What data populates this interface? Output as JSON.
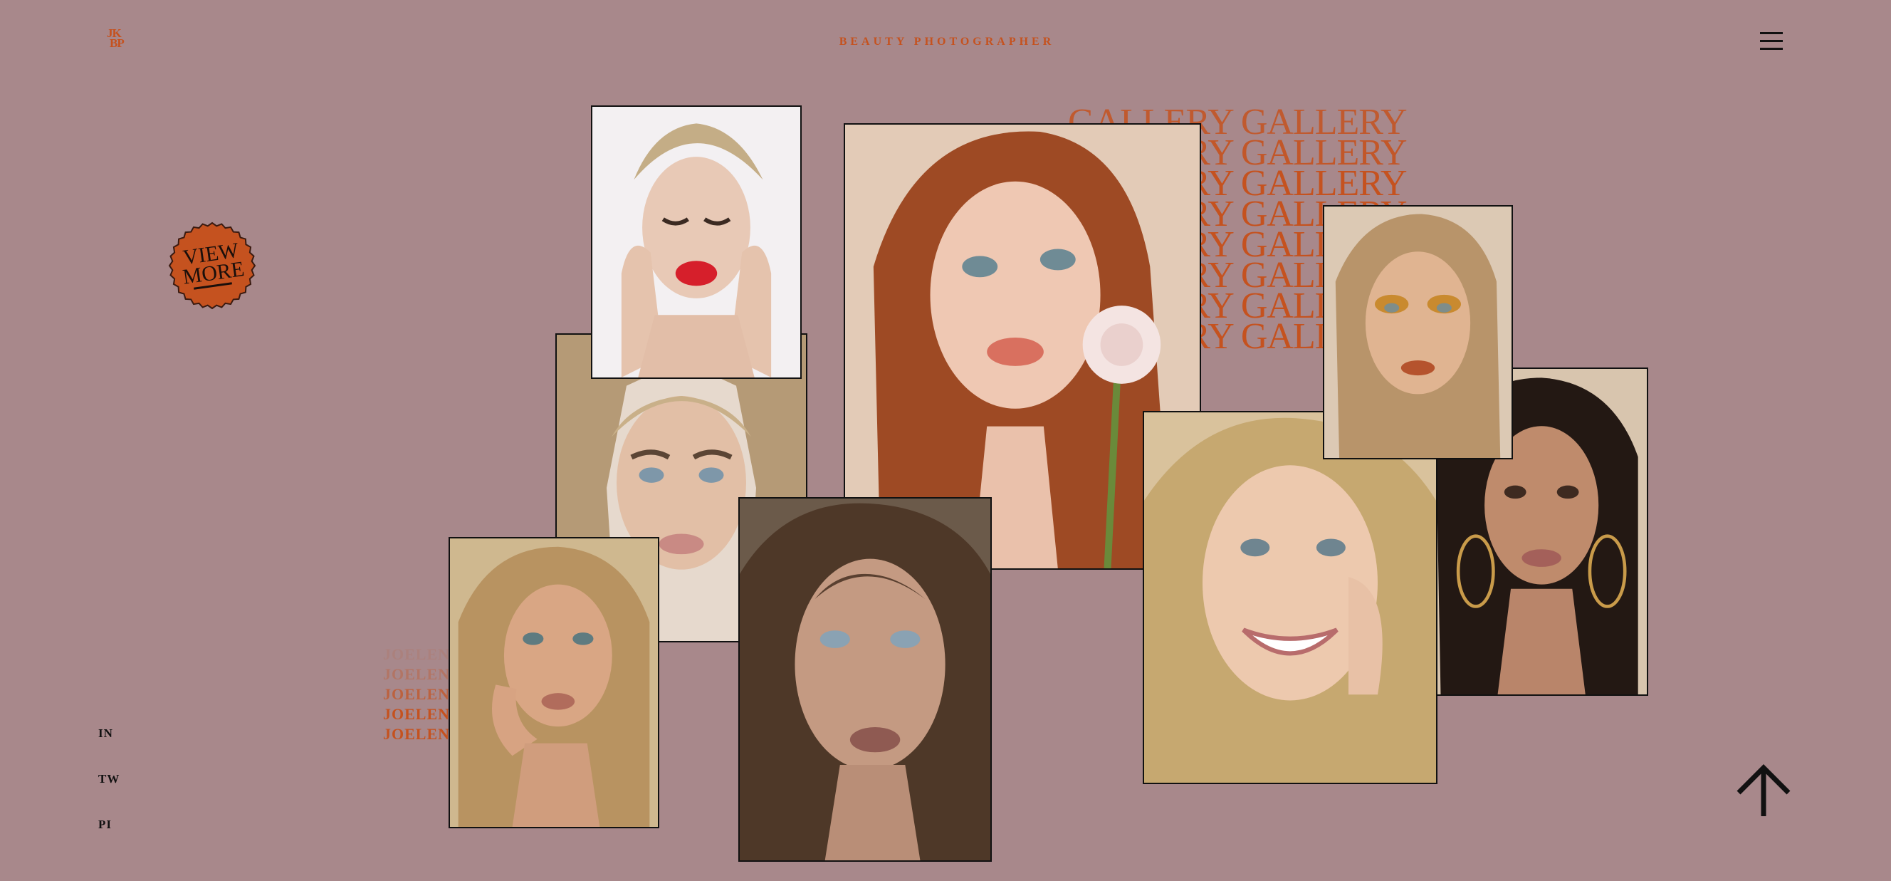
{
  "header": {
    "logo_line1": "JK",
    "logo_line2": "BP",
    "title": "BEAUTY PHOTOGRAPHER",
    "menu_icon": "hamburger-menu-icon"
  },
  "badge": {
    "line1": "VIEW",
    "line2": "MORE",
    "color": "#c5521f"
  },
  "background_text": {
    "gallery": [
      "GALLERY GALLERY",
      "GALLERY GALLERY",
      "GALLERY GALLERY",
      "GALLERY GALLERY",
      "GALLERY GALLERY",
      "GALLERY GALLERY",
      "GALLERY GALLERY",
      "GALLERY GALLERY"
    ],
    "joelene": [
      "JOELENE",
      "JOELENE",
      "JOELENE",
      "JOELENE",
      "JOELENE"
    ]
  },
  "photos": [
    "portrait-blonde-bangs",
    "portrait-red-lips-eyes-closed",
    "portrait-redhead-with-ranunculus-flower",
    "portrait-orange-eyeshadow",
    "portrait-brunette-hoop-earrings",
    "portrait-smiling-blonde",
    "portrait-blonde-hand-on-face",
    "portrait-freckles-brunette"
  ],
  "social": {
    "instagram": "IN",
    "twitter": "TW",
    "pinterest": "PI"
  },
  "scroll_top_icon": "arrow-up-icon",
  "colors": {
    "background": "#a8888b",
    "accent": "#c5521f",
    "ink": "#111111"
  }
}
